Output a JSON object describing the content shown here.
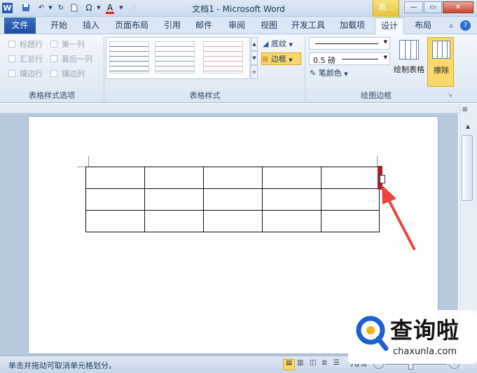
{
  "window": {
    "title": "文档1 - Microsoft Word",
    "context_tab": "表...",
    "app_icon_letter": "W"
  },
  "tabs": {
    "file": "文件",
    "items": [
      "开始",
      "插入",
      "页面布局",
      "引用",
      "邮件",
      "审阅",
      "视图",
      "开发工具",
      "加载项",
      "设计",
      "布局"
    ],
    "active": "设计"
  },
  "ribbon": {
    "style_options": {
      "group_label": "表格样式选项",
      "items": [
        "标题行",
        "第一列",
        "汇总行",
        "最后一列",
        "镶边行",
        "镶边列"
      ]
    },
    "table_styles": {
      "group_label": "表格样式",
      "shading_label": "底纹",
      "borders_label": "边框"
    },
    "draw_borders": {
      "group_label": "绘图边框",
      "weight_value": "0.5 磅",
      "pen_color_label": "笔颜色",
      "draw_table_label": "绘制表格",
      "eraser_label": "擦除"
    }
  },
  "status": {
    "message": "单击并拖动可取消单元格划分。",
    "zoom": "78%"
  },
  "table": {
    "rows": 3,
    "cols": 5
  },
  "watermark": {
    "brand": "查询啦",
    "url": "chaxunla.com"
  },
  "colors": {
    "file_tab": "#2a5caa",
    "eraser_highlight": "#fbd86b",
    "arrow": "#e8463c",
    "brand": "#1c5fd0"
  }
}
